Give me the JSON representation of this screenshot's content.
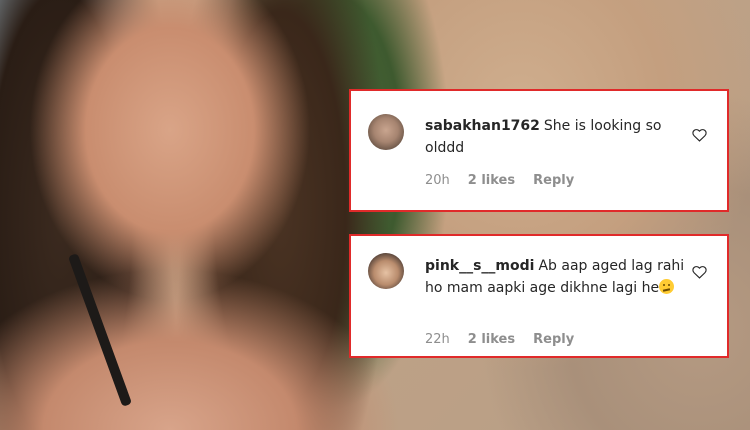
{
  "comments": [
    {
      "username": "sabakhan1762",
      "text": "She is looking so olddd",
      "time": "20h",
      "likes": "2 likes",
      "reply": "Reply"
    },
    {
      "username": "pink__s__modi",
      "text": "Ab aap aged lag rahi ho mam aapki age dikhne lagi he",
      "emoji": "confused-face-emoji",
      "time": "22h",
      "likes": "2 likes",
      "reply": "Reply"
    }
  ],
  "colors": {
    "card_border": "#e02a2a",
    "text": "#262626",
    "meta": "#8e8e8e"
  }
}
